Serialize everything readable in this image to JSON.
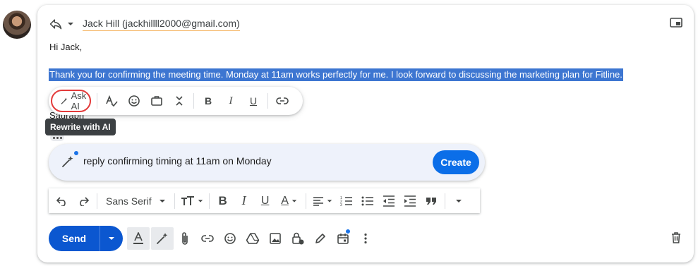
{
  "compose": {
    "recipient": "Jack Hill (jackhillll2000@gmail.com)",
    "greeting": "Hi Jack,",
    "selected_text": "Thank you for confirming the meeting time. Monday at 11am works perfectly for me. I look forward to discussing the marketing plan for Fitline.",
    "signature": "Saurabh"
  },
  "popup": {
    "ask_ai_label": "Ask AI",
    "icons": [
      "spellcheck-icon",
      "emoji-icon",
      "briefcase-icon",
      "collapse-icon",
      "bold-icon",
      "italic-icon",
      "underline-icon",
      "link-icon"
    ]
  },
  "tooltip": "Rewrite with AI",
  "ai_prompt": {
    "value": "reply confirming timing at 11am on Monday",
    "create_label": "Create"
  },
  "toolbar": {
    "font": "Sans Serif"
  },
  "bottom": {
    "send_label": "Send"
  },
  "colors": {
    "accent": "#0b57d0",
    "selection": "#3d76d1",
    "highlight_ring": "#e33a3a"
  }
}
